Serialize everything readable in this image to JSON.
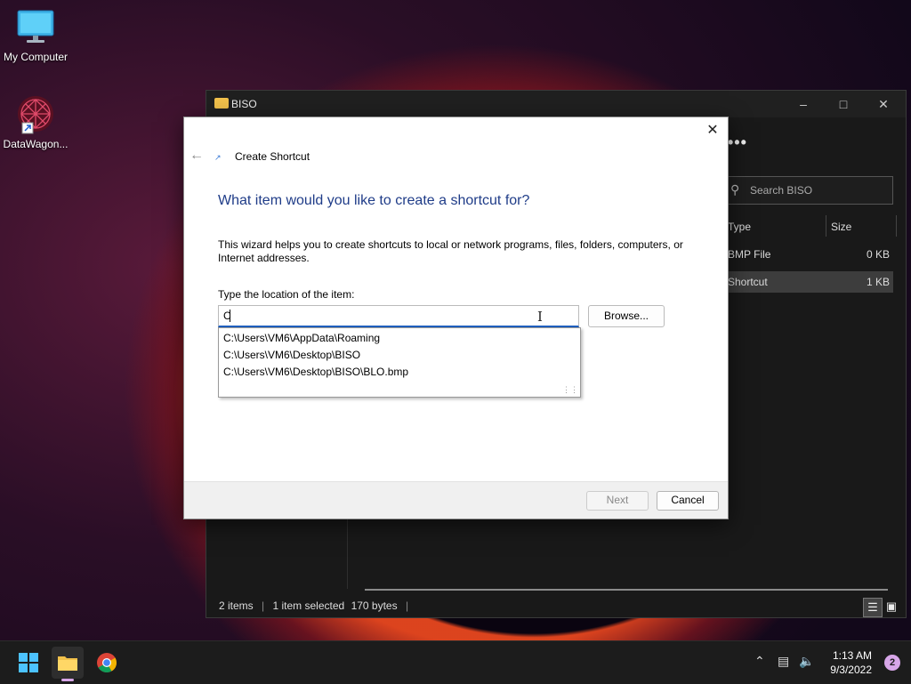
{
  "desktop": {
    "icons": [
      {
        "label": "My Computer",
        "icon": "monitor-icon"
      },
      {
        "label": "DataWagon...",
        "icon": "datawagon-shortcut-icon"
      }
    ]
  },
  "explorer": {
    "title": "BISO",
    "search_placeholder": "Search BISO",
    "columns": {
      "type": "Type",
      "size": "Size"
    },
    "rows": [
      {
        "type": "BMP File",
        "size": "0 KB",
        "selected": false
      },
      {
        "type": "Shortcut",
        "size": "1 KB",
        "selected": true
      }
    ],
    "status": {
      "items": "2 items",
      "selected": "1 item selected",
      "bytes": "170 bytes"
    }
  },
  "dialog": {
    "title": "Create Shortcut",
    "heading": "What item would you like to create a shortcut for?",
    "description": "This wizard helps you to create shortcuts to local or network programs, files, folders, computers, or Internet addresses.",
    "location_label": "Type the location of the item:",
    "location_value": "C",
    "browse_label": "Browse...",
    "suggestions": [
      "C:\\Users\\VM6\\AppData\\Roaming",
      "C:\\Users\\VM6\\Desktop\\BISO",
      "C:\\Users\\VM6\\Desktop\\BISO\\BLO.bmp"
    ],
    "next_label": "Next",
    "cancel_label": "Cancel"
  },
  "taskbar": {
    "time": "1:13 AM",
    "date": "9/3/2022",
    "notification_count": "2"
  },
  "colors": {
    "accent_blue": "#1f5fbf",
    "heading_blue": "#1f3c88",
    "folder_yellow": "#f2c14b"
  }
}
